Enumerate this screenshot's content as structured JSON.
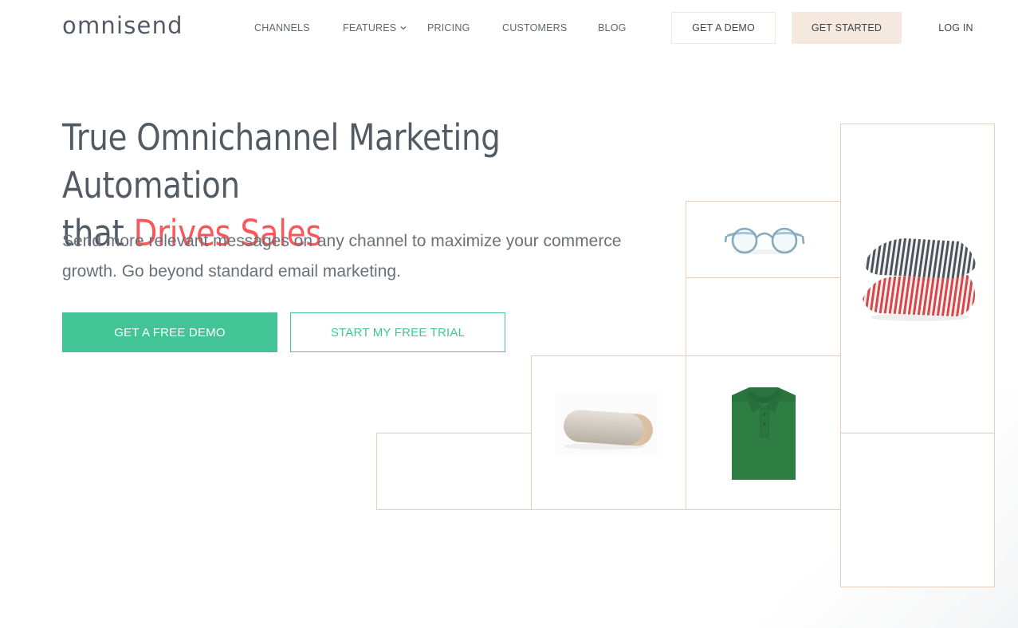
{
  "header": {
    "logo": "omnisend",
    "nav": [
      {
        "label": "CHANNELS",
        "has_dropdown": false
      },
      {
        "label": "FEATURES",
        "has_dropdown": true
      },
      {
        "label": "PRICING",
        "has_dropdown": false
      },
      {
        "label": "CUSTOMERS",
        "has_dropdown": false
      },
      {
        "label": "BLOG",
        "has_dropdown": false
      }
    ],
    "chevron_glyph": "⌄",
    "get_demo_label": "GET A DEMO",
    "get_started_label": "GET STARTED",
    "login_label": "LOG IN"
  },
  "hero": {
    "title_line1": "True Omnichannel Marketing Automation",
    "title_line2_prefix": "that ",
    "title_accent": "Drives Sales",
    "subtitle": "Send more relevant messages on any channel to maximize your commerce growth. Go beyond standard email marketing.",
    "cta_primary": "GET A FREE DEMO",
    "cta_secondary": "START MY FREE TRIAL"
  },
  "products": [
    {
      "name": "glasses",
      "description": "Light blue round eyeglasses"
    },
    {
      "name": "pillows",
      "description": "Stacked striped pillows (gray and red)"
    },
    {
      "name": "speaker",
      "description": "Beige pill-shaped bluetooth speaker"
    },
    {
      "name": "polo-shirt",
      "description": "Folded green polo shirt"
    }
  ],
  "colors": {
    "text": "#525a64",
    "accent_red": "#f9575b",
    "brand_green": "#43c497",
    "grid_border": "#e8cfbc",
    "started_bg": "#f5e9df"
  }
}
